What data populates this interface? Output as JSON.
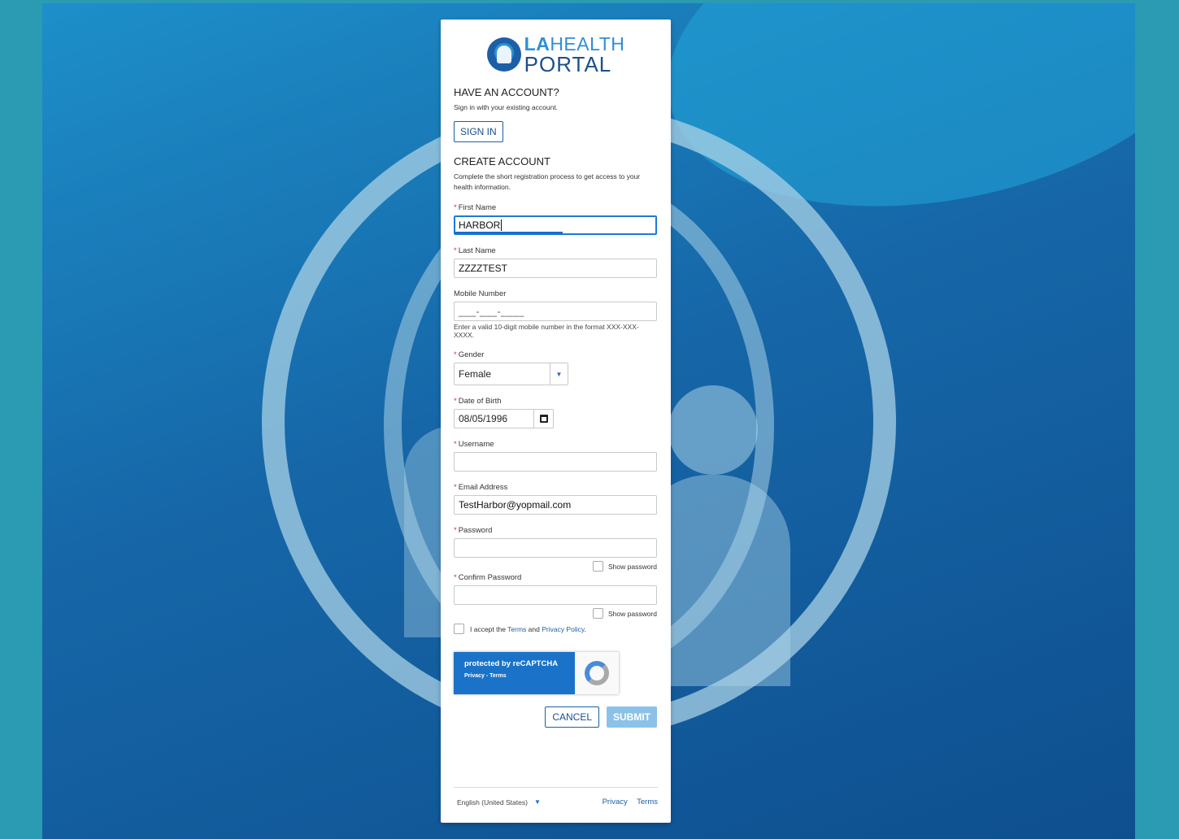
{
  "brand": {
    "line1_bold": "LA",
    "line1_thin": "HEALTH",
    "line2": "PORTAL"
  },
  "have_account": {
    "title": "HAVE AN ACCOUNT?",
    "description": "Sign in with your existing account.",
    "sign_in_label": "SIGN IN"
  },
  "create_account": {
    "title": "CREATE ACCOUNT",
    "description": "Complete the short registration process to get access to your health information."
  },
  "required_marker": "*",
  "form": {
    "first_name": {
      "label": "First Name",
      "value": "HARBOR"
    },
    "last_name": {
      "label": "Last Name",
      "value": "ZZZZTEST"
    },
    "mobile": {
      "label": "Mobile Number",
      "mask": "___-___-____",
      "hint": "Enter a valid 10-digit mobile number in the format XXX-XXX-XXXX."
    },
    "gender": {
      "label": "Gender",
      "value": "Female"
    },
    "dob": {
      "label": "Date of Birth",
      "value": "08/05/1996"
    },
    "username": {
      "label": "Username",
      "value": ""
    },
    "email": {
      "label": "Email Address",
      "value": "TestHarbor@yopmail.com"
    },
    "password": {
      "label": "Password",
      "value": "",
      "show_label": "Show password"
    },
    "confirm_password": {
      "label": "Confirm Password",
      "value": "",
      "show_label": "Show password"
    },
    "accept": {
      "prefix": "I accept the ",
      "terms": "Terms",
      "and": " and ",
      "privacy": "Privacy Policy",
      "suffix": "."
    }
  },
  "recaptcha": {
    "title": "protected by reCAPTCHA",
    "privacy": "Privacy",
    "sep": " - ",
    "terms": "Terms"
  },
  "actions": {
    "cancel": "CANCEL",
    "submit": "SUBMIT"
  },
  "footer": {
    "language": "English (United States)",
    "privacy": "Privacy",
    "terms": "Terms"
  },
  "icons": {
    "logo": "la-health-portal-logo",
    "select_arrow": "caret-down-icon",
    "calendar": "calendar-icon",
    "recaptcha": "recaptcha-icon"
  }
}
